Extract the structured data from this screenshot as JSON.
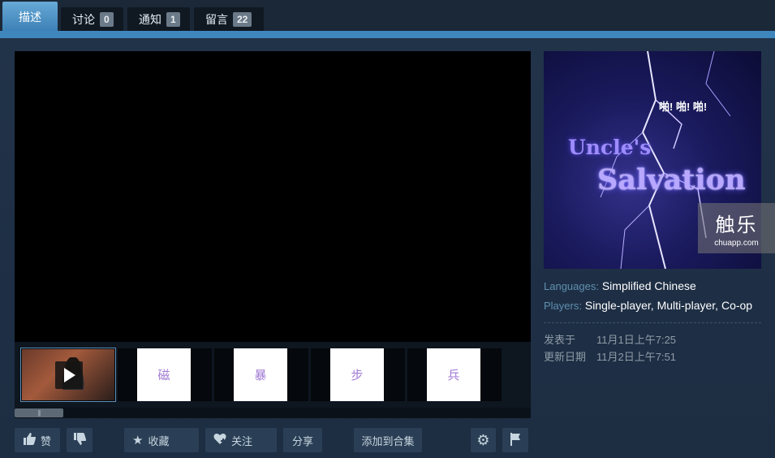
{
  "tabs": [
    {
      "label": "描述",
      "count": null
    },
    {
      "label": "讨论",
      "count": "0"
    },
    {
      "label": "通知",
      "count": "1"
    },
    {
      "label": "留言",
      "count": "22"
    }
  ],
  "thumbnails": [
    "磁",
    "暴",
    "步",
    "兵"
  ],
  "scrollbar_grip": "|||",
  "actions": {
    "like_label": "赞",
    "favorite_label": "收藏",
    "follow_label": "关注",
    "share_label": "分享",
    "add_collection_label": "添加到合集"
  },
  "cover": {
    "exclaim": "啪! 啪! 啪!",
    "title_line1": "Uncle's",
    "title_line2": "Salvation"
  },
  "watermark": {
    "big": "触乐",
    "small": "chuapp.com"
  },
  "details": {
    "languages_key": "Languages:",
    "languages_value": "Simplified Chinese",
    "players_key": "Players:",
    "players_values": [
      "Single-player",
      "Multi-player",
      "Co-op"
    ]
  },
  "meta": {
    "posted_label": "发表于",
    "posted_value": "11月1日上午7:25",
    "updated_label": "更新日期",
    "updated_value": "11月2日上午7:51"
  },
  "colors": {
    "accent_tab": "#67a9d6",
    "strip": "#3f86bd",
    "background": "#1b2838",
    "label_blue": "#5f8fb0"
  }
}
